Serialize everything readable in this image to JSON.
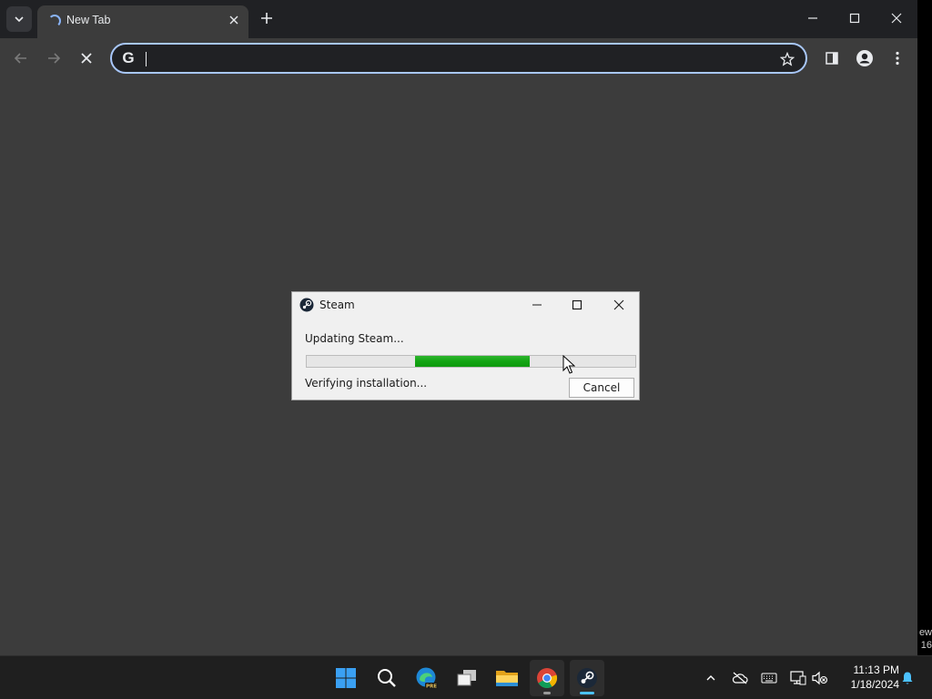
{
  "browser": {
    "tab": {
      "title": "New Tab",
      "loading": true
    },
    "omnibox": {
      "value": "",
      "placeholder": ""
    }
  },
  "dialog": {
    "title": "Steam",
    "status": "Updating Steam...",
    "substatus": "Verifying installation...",
    "progress": {
      "segment_start": 0.33,
      "segment_end": 0.68,
      "color": "#13a513"
    },
    "cancel_label": "Cancel"
  },
  "edge_clip": {
    "line1": "ew",
    "line2": "16"
  },
  "taskbar": {
    "pinned": [
      "start-icon",
      "search-icon",
      "edge-beta-icon",
      "task-view-icon",
      "file-explorer-icon",
      "chrome-icon",
      "steam-icon"
    ],
    "edge_badge": "PRE",
    "clock": {
      "time": "11:13 PM",
      "date": "1/18/2024"
    }
  }
}
